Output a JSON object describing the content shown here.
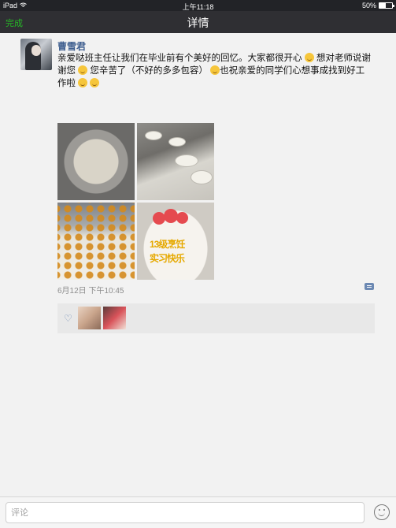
{
  "status_bar": {
    "carrier": "iPad",
    "time": "上午11:18",
    "battery_text": "50%",
    "battery_level": 0.5
  },
  "nav": {
    "done_label": "完成",
    "title": "详情"
  },
  "post": {
    "username": "曹雪君",
    "text_parts": [
      "亲爱哒班主任让我们在毕业前有个美好的回忆。大家都很开心 ",
      " 想对老师说谢谢您 ",
      " 您辛苦了（不好的多多包容） ",
      "也祝亲爱的同学们心想事成找到好工作啦 ",
      " "
    ],
    "cake_text_line1": "13级烹饪",
    "cake_text_line2": "实习快乐",
    "timestamp": "6月12日 下午10:45"
  },
  "comment_bar": {
    "placeholder": "评论"
  },
  "colors": {
    "accent_green": "#26b926",
    "username_blue": "#3e5e8f",
    "navbar": "#2f2f33"
  }
}
